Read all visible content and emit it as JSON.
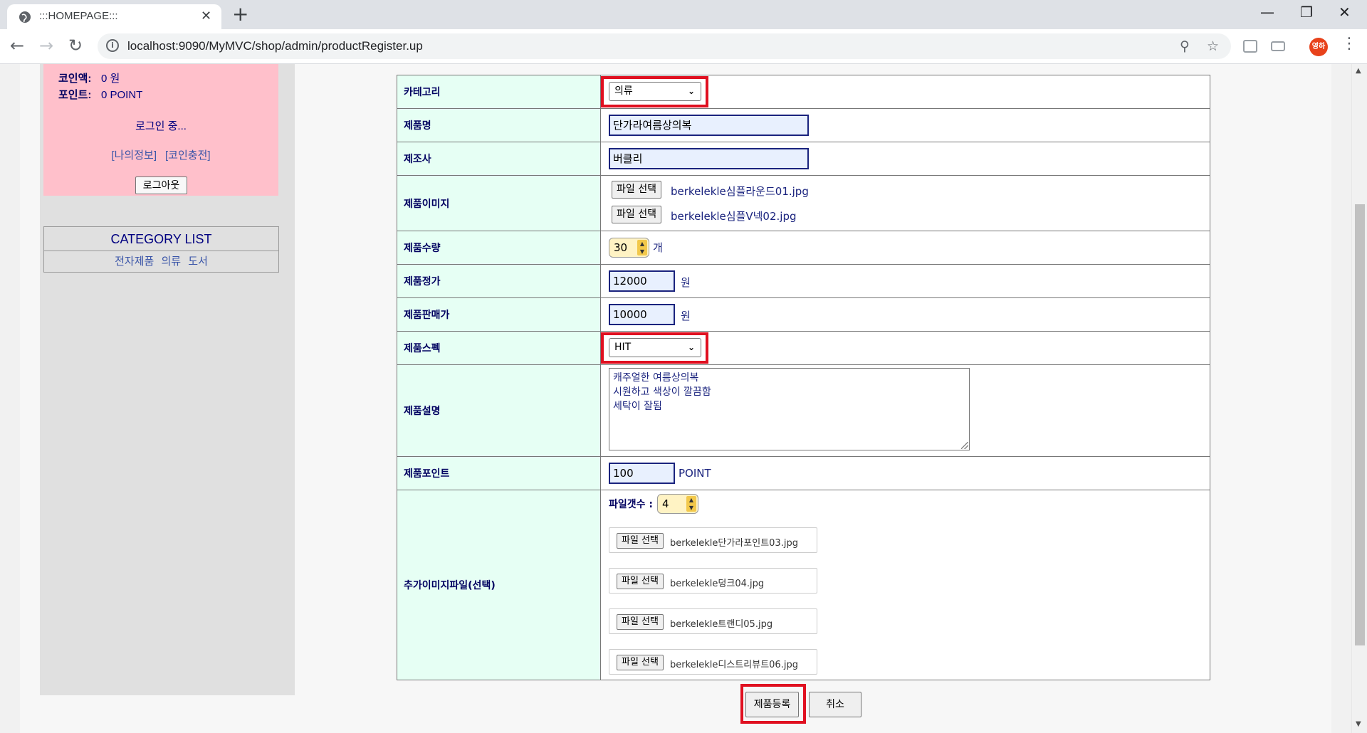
{
  "browser": {
    "tab_title": ":::HOMEPAGE:::",
    "url": "localhost:9090/MyMVC/shop/admin/productRegister.up",
    "avatar_text": "영하"
  },
  "sidebar": {
    "coin_label": "코인액:",
    "coin_value": "0 원",
    "point_label": "포인트:",
    "point_value": "0 POINT",
    "status": "로그인 중...",
    "links": [
      "[나의정보]",
      "[코인충전]"
    ],
    "logout": "로그아웃",
    "category_title": "CATEGORY LIST",
    "categories": [
      "전자제품",
      "의류",
      "도서"
    ]
  },
  "form": {
    "category": {
      "label": "카테고리",
      "value": "의류"
    },
    "name": {
      "label": "제품명",
      "value": "단가라여름상의복"
    },
    "maker": {
      "label": "제조사",
      "value": "버클리"
    },
    "images": {
      "label": "제품이미지",
      "button": "파일 선택",
      "files": [
        "berkelekle심플라운드01.jpg",
        "berkelekle심플V넥02.jpg"
      ]
    },
    "quantity": {
      "label": "제품수량",
      "value": "30",
      "unit": "개"
    },
    "price": {
      "label": "제품정가",
      "value": "12000",
      "unit": "원"
    },
    "sale_price": {
      "label": "제품판매가",
      "value": "10000",
      "unit": "원"
    },
    "spec": {
      "label": "제품스펙",
      "value": "HIT"
    },
    "description": {
      "label": "제품설명",
      "lines": [
        "캐주얼한 여름상의복",
        "시원하고 색상이 깔끔함",
        "세탁이 잘됨"
      ]
    },
    "point": {
      "label": "제품포인트",
      "value": "100",
      "unit": "POINT"
    },
    "extra": {
      "label": "추가이미지파일(선택)",
      "count_label": "파일갯수 :",
      "count_value": "4",
      "button": "파일 선택",
      "files": [
        "berkelekle단가라포인트03.jpg",
        "berkelekle덩크04.jpg",
        "berkelekle트랜디05.jpg",
        "berkelekle디스트리뷰트06.jpg"
      ]
    },
    "submit": "제품등록",
    "cancel": "취소"
  }
}
